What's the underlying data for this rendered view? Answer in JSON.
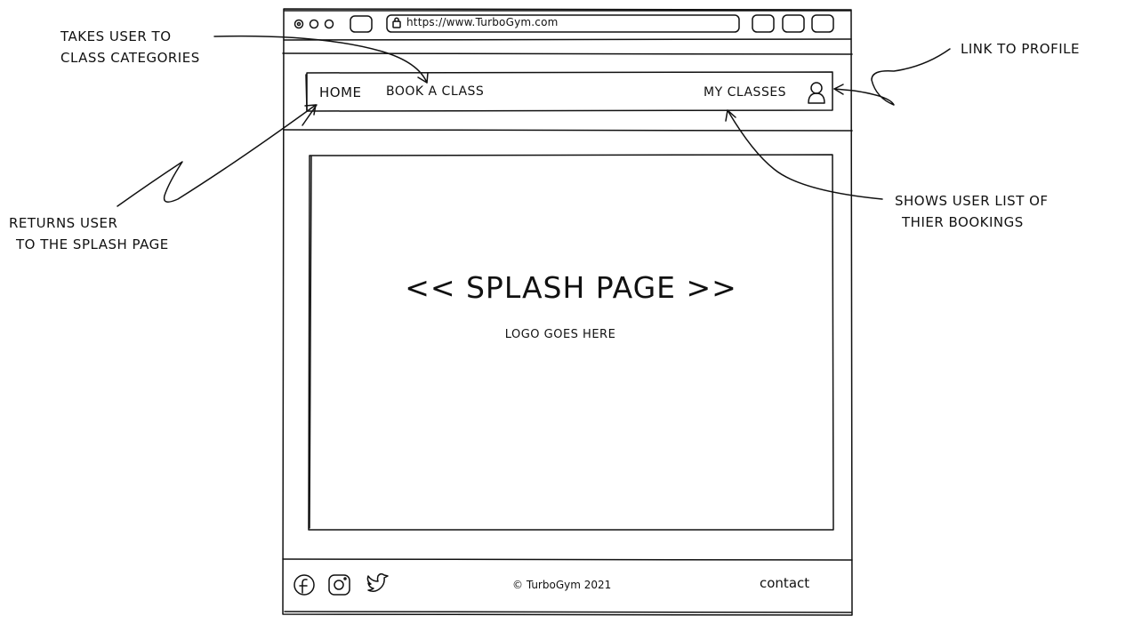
{
  "browser": {
    "url": "https://www.TurboGym.com"
  },
  "nav": {
    "home": "HOME",
    "book_class": "Book A CLASS",
    "my_classes": "MY CLASSES"
  },
  "hero": {
    "title": "<< SPLASH PAGE >>",
    "subtitle": "LOGO GOES HERE"
  },
  "footer": {
    "copyright": "© TurboGym 2021",
    "contact": "contact"
  },
  "annotations": {
    "class_categories": [
      "TAKES USER TO",
      "CLASS CATEGORIES"
    ],
    "profile": "LINK TO PROFILE",
    "splash": [
      "RETURNS USER",
      "TO THE SPLASH PAGE"
    ],
    "bookings": [
      "SHOWS USER LIST OF",
      "THIER BOOKINGS"
    ]
  },
  "icons": {
    "browser": [
      "close-dot-icon",
      "minimize-dot-icon",
      "maximize-dot-icon",
      "tab-icon",
      "lock-icon"
    ],
    "nav": [
      "user-profile-icon"
    ],
    "footer": [
      "facebook-icon",
      "instagram-icon",
      "twitter-icon"
    ]
  }
}
